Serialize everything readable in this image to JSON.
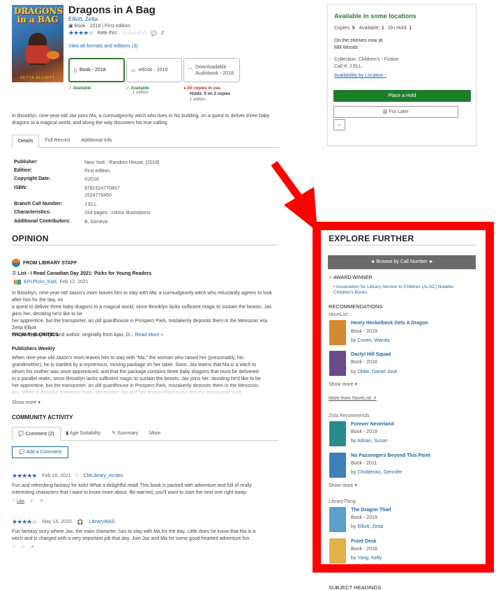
{
  "book": {
    "cover_title": "DRAGONS in a BAG",
    "cover_author": "ZETTA ELLIOTT",
    "title": "Dragons in A Bag",
    "author": "Elliott, Zetta",
    "format_line": "Book - 2018 | First edition.",
    "rate_this": "Rate this:",
    "comment_count": "2",
    "rating_stars": "★★★★☆",
    "empty_stars": "☆☆☆☆☆",
    "view_all": "View all formats and editions (3)"
  },
  "formats": [
    {
      "label": "Book - 2018",
      "status": "Available",
      "sub": ""
    },
    {
      "label": "eBook - 2018",
      "status": "Available",
      "sub": "1 edition"
    },
    {
      "label": "Downloadable Audiobook - 2018",
      "status": "All copies in use.",
      "holds": "Holds: 0 on 3 copies",
      "sub": "1 edition"
    }
  ],
  "description": "In Brooklyn, nine-year-old Jax joins Ma, a curmudgeonly witch who lives in his building, on a quest to deliver three baby dragons to a magical world, and along the way discovers his true calling.",
  "tabs": [
    "Details",
    "Full Record",
    "Additional Info"
  ],
  "details": [
    {
      "label": "Publisher:",
      "value": "New York : Random House, [2018]"
    },
    {
      "label": "Edition:",
      "value": "First edition."
    },
    {
      "label": "Copyright Date:",
      "value": "©2018"
    },
    {
      "label": "ISBN:",
      "value": "9781524770457"
    },
    {
      "label": "",
      "value": "1524770450"
    },
    {
      "label": "Branch Call Number:",
      "value": "J ELL"
    },
    {
      "label": "Characteristics:",
      "value": "154 pages : colour illustrations"
    },
    {
      "label": "Additional Contributors:",
      "value": "B, Geneva"
    }
  ],
  "opinion": {
    "heading": "OPINION",
    "from_staff": "FROM LIBRARY STAFF",
    "list_prefix": "List -",
    "list_name": "I Read Canadian Day 2021: Picks for Young Readers",
    "list_user": "EPLPicks_Kids",
    "list_date": "Feb 12, 2021",
    "staff_review": "In Brooklyn, nine-year-old Jaxon's mom leaves him to stay with Ma, a curmudgeonly witch who reluctantly agrees to look after him for the day, on a quest to deliver three baby dragons to a magical world, since Brooklyn lacks sufficient magic to sustain the beasts. Jax joins her, deciding he'd like to be her apprentice, but the transporter, an old guardhouse in Prospect Park, mistakenly deposits them in the Mesozoic era. When a dinosaur threatens them, Ma pushes Jax and her dragon-filled purse into the transporter, and",
    "staff_short_1": "In Brooklyn, nine-year-old Jaxon's mom leaves him to stay with Ma, a curmudgeonly witch who reluctantly agrees to look after him for the day, on",
    "staff_short_2": "a quest to deliver three baby dragons to a magical world, since Brooklyn lacks sufficient magic to sustain the beasts. Jax joins her, deciding he'd like to be",
    "staff_short_3": "her apprentice, but the transporter, an old guardhouse in Prospect Park, mistakenly deposits them in the Mesozoic era. Zetta Elliott",
    "staff_short_4": "is a poet, playwright and author, originally from Ajax, O...",
    "read_more": "Read More »",
    "from_critics": "FROM THE CRITICS",
    "critic_source": "Publishers Weekly",
    "critic_1": "When nine-year-old Jaxon's mom leaves him to stay with \"Ma,\" the woman who raised her (presumably, his",
    "critic_2": "grandmother), he is startled by a mysterious, moving package on her table. Soon, Jax learns that Ma is a witch to",
    "critic_3": "whom his mother was once apprenticed, and that the package contains three baby dragons that must be delivered",
    "critic_4": "to a parallel realm, since Brooklyn lacks sufficient magic to sustain the beasts. Jax joins her, deciding he'd like to be",
    "critic_5": "her apprentice, but the transporter, an old guardhouse in Prospect Park, mistakenly deposits them in the Mesozoic",
    "critic_6": "era. When a dinosaur threatens them, Ma pushes Jax and her dragon-filled purse into the transporter, and",
    "show_more": "Show more ▾"
  },
  "community": {
    "heading": "COMMUNITY ACTIVITY",
    "tabs": [
      "Comment (2)",
      "Age Suitability",
      "Summary",
      "More"
    ],
    "add_comment": "Add a Comment",
    "comments": [
      {
        "stars": "★★★★★",
        "date": "Feb 18, 2021",
        "user": "CMLibrary_ecrites",
        "text1": "Fun and refreshing fantasy for kids! What a delightful read! This book is packed with adventure and full of really",
        "text2": "interesting characters that I want to know more about. Be warned, you'll want to start the next one right away",
        "like": "Like"
      },
      {
        "stars": "★★★★☆",
        "date": "May 14, 2020",
        "user": "LibraryWAS",
        "text1": "Fun fantasy story where Jax, the main character, has to stay with Ma for the day. Little does he know that Ma is a",
        "text2": "witch and is charged with a very important job that day. Join Jax and Ma for some good-hearted adventure fun.",
        "like": ""
      }
    ]
  },
  "availability": {
    "status": "Available in some locations",
    "copies_label": "Copies:",
    "copies": "9",
    "available_label": "Available:",
    "available": "1",
    "onhold_label": "On Hold:",
    "onhold": "1",
    "shelves_line": "On the shelves now at",
    "branch": "Mill Woods",
    "collection": "Collection: Children's - Fiction",
    "call": "Call #:   J ELL",
    "by_location": "Availability by Location",
    "place_hold": "Place a Hold",
    "for_later": "For Later",
    "caret": "⌄"
  },
  "explore": {
    "heading": "EXPLORE FURTHER",
    "browse": "◄   Browse by Call Number   ►",
    "award_heading": "AWARD WINNER",
    "award": "Association for Library Service to Children (ALSC) Notable Children's Books",
    "rec_heading": "RECOMMENDATIONS",
    "groups": [
      {
        "source": "NoveList",
        "items": [
          {
            "title": "Henry Heckelbeck Gets A Dragon",
            "sub": "Book - 2019",
            "by": "by",
            "author": "Coven, Wanda",
            "color": "#d4892f"
          },
          {
            "title": "Dactyl Hill Squad",
            "sub": "Book - 2018",
            "by": "by",
            "author": "Older, Daniel José",
            "color": "#6b4a8a"
          }
        ],
        "show_more": "Show more ▾",
        "more_from": "More from NoveList ↗"
      },
      {
        "source": "Zola Recommends",
        "items": [
          {
            "title": "Forever Neverland",
            "sub": "Book - 2019",
            "by": "by",
            "author": "Adrian, Susan",
            "color": "#2b8a8e"
          },
          {
            "title": "No Passengers Beyond This Point",
            "sub": "Book - 2011",
            "by": "by",
            "author": "Choldenko, Gennifer",
            "color": "#3d7fb8"
          }
        ],
        "show_more": "Show more ▾"
      },
      {
        "source": "LibraryThing",
        "items": [
          {
            "title": "The Dragon Thief",
            "sub": "Book - 2019",
            "by": "by",
            "author": "Elliott, Zetta",
            "color": "#5aa0c8"
          },
          {
            "title": "Front Desk",
            "sub": "Book - 2018",
            "by": "by",
            "author": "Yang, Kelly",
            "color": "#e0b24a"
          }
        ],
        "show_more": "Show more"
      }
    ],
    "subject_heading": "SUBJECT HEADINGS"
  },
  "colors": {
    "highlight": "#ff0000",
    "accent_green": "#1b7f2a",
    "link": "#1f66a8"
  }
}
